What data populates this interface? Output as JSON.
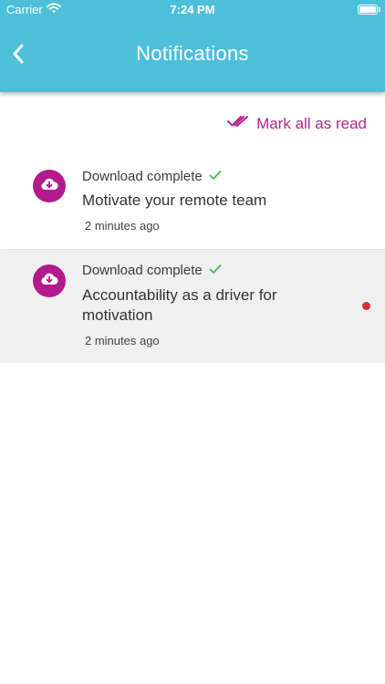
{
  "status_bar": {
    "carrier": "Carrier",
    "time": "7:24 PM",
    "icons": [
      "wifi-icon",
      "battery-icon"
    ]
  },
  "header": {
    "back_icon": "chevron-left-icon",
    "title": "Notifications"
  },
  "actions": {
    "mark_all_label": "Mark all as read",
    "mark_all_icon": "double-check-icon"
  },
  "notifications": [
    {
      "icon": "cloud-download-icon",
      "status": "Download complete",
      "status_icon": "check-icon",
      "title": "Motivate your remote team",
      "time": "2 minutes ago",
      "unread": false
    },
    {
      "icon": "cloud-download-icon",
      "status": "Download complete",
      "status_icon": "check-icon",
      "title": "Accountability as a driver for motivation",
      "time": "2 minutes ago",
      "unread": true
    }
  ],
  "colors": {
    "header_bg": "#4ebfd9",
    "accent": "#b2268f",
    "avatar_bg": "#b31a8c",
    "check": "#3fbf5a",
    "unread_dot": "#d32f2f",
    "unread_row_bg": "#f0f0f0"
  }
}
